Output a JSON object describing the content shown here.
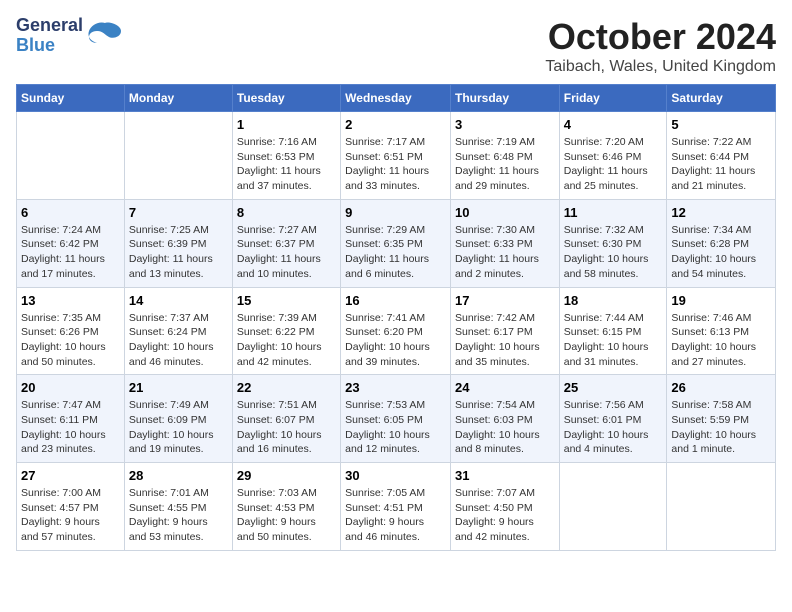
{
  "header": {
    "logo_general": "General",
    "logo_blue": "Blue",
    "month": "October 2024",
    "location": "Taibach, Wales, United Kingdom"
  },
  "weekdays": [
    "Sunday",
    "Monday",
    "Tuesday",
    "Wednesday",
    "Thursday",
    "Friday",
    "Saturday"
  ],
  "weeks": [
    [
      {
        "day": "",
        "content": ""
      },
      {
        "day": "",
        "content": ""
      },
      {
        "day": "1",
        "content": "Sunrise: 7:16 AM\nSunset: 6:53 PM\nDaylight: 11 hours\nand 37 minutes."
      },
      {
        "day": "2",
        "content": "Sunrise: 7:17 AM\nSunset: 6:51 PM\nDaylight: 11 hours\nand 33 minutes."
      },
      {
        "day": "3",
        "content": "Sunrise: 7:19 AM\nSunset: 6:48 PM\nDaylight: 11 hours\nand 29 minutes."
      },
      {
        "day": "4",
        "content": "Sunrise: 7:20 AM\nSunset: 6:46 PM\nDaylight: 11 hours\nand 25 minutes."
      },
      {
        "day": "5",
        "content": "Sunrise: 7:22 AM\nSunset: 6:44 PM\nDaylight: 11 hours\nand 21 minutes."
      }
    ],
    [
      {
        "day": "6",
        "content": "Sunrise: 7:24 AM\nSunset: 6:42 PM\nDaylight: 11 hours\nand 17 minutes."
      },
      {
        "day": "7",
        "content": "Sunrise: 7:25 AM\nSunset: 6:39 PM\nDaylight: 11 hours\nand 13 minutes."
      },
      {
        "day": "8",
        "content": "Sunrise: 7:27 AM\nSunset: 6:37 PM\nDaylight: 11 hours\nand 10 minutes."
      },
      {
        "day": "9",
        "content": "Sunrise: 7:29 AM\nSunset: 6:35 PM\nDaylight: 11 hours\nand 6 minutes."
      },
      {
        "day": "10",
        "content": "Sunrise: 7:30 AM\nSunset: 6:33 PM\nDaylight: 11 hours\nand 2 minutes."
      },
      {
        "day": "11",
        "content": "Sunrise: 7:32 AM\nSunset: 6:30 PM\nDaylight: 10 hours\nand 58 minutes."
      },
      {
        "day": "12",
        "content": "Sunrise: 7:34 AM\nSunset: 6:28 PM\nDaylight: 10 hours\nand 54 minutes."
      }
    ],
    [
      {
        "day": "13",
        "content": "Sunrise: 7:35 AM\nSunset: 6:26 PM\nDaylight: 10 hours\nand 50 minutes."
      },
      {
        "day": "14",
        "content": "Sunrise: 7:37 AM\nSunset: 6:24 PM\nDaylight: 10 hours\nand 46 minutes."
      },
      {
        "day": "15",
        "content": "Sunrise: 7:39 AM\nSunset: 6:22 PM\nDaylight: 10 hours\nand 42 minutes."
      },
      {
        "day": "16",
        "content": "Sunrise: 7:41 AM\nSunset: 6:20 PM\nDaylight: 10 hours\nand 39 minutes."
      },
      {
        "day": "17",
        "content": "Sunrise: 7:42 AM\nSunset: 6:17 PM\nDaylight: 10 hours\nand 35 minutes."
      },
      {
        "day": "18",
        "content": "Sunrise: 7:44 AM\nSunset: 6:15 PM\nDaylight: 10 hours\nand 31 minutes."
      },
      {
        "day": "19",
        "content": "Sunrise: 7:46 AM\nSunset: 6:13 PM\nDaylight: 10 hours\nand 27 minutes."
      }
    ],
    [
      {
        "day": "20",
        "content": "Sunrise: 7:47 AM\nSunset: 6:11 PM\nDaylight: 10 hours\nand 23 minutes."
      },
      {
        "day": "21",
        "content": "Sunrise: 7:49 AM\nSunset: 6:09 PM\nDaylight: 10 hours\nand 19 minutes."
      },
      {
        "day": "22",
        "content": "Sunrise: 7:51 AM\nSunset: 6:07 PM\nDaylight: 10 hours\nand 16 minutes."
      },
      {
        "day": "23",
        "content": "Sunrise: 7:53 AM\nSunset: 6:05 PM\nDaylight: 10 hours\nand 12 minutes."
      },
      {
        "day": "24",
        "content": "Sunrise: 7:54 AM\nSunset: 6:03 PM\nDaylight: 10 hours\nand 8 minutes."
      },
      {
        "day": "25",
        "content": "Sunrise: 7:56 AM\nSunset: 6:01 PM\nDaylight: 10 hours\nand 4 minutes."
      },
      {
        "day": "26",
        "content": "Sunrise: 7:58 AM\nSunset: 5:59 PM\nDaylight: 10 hours\nand 1 minute."
      }
    ],
    [
      {
        "day": "27",
        "content": "Sunrise: 7:00 AM\nSunset: 4:57 PM\nDaylight: 9 hours\nand 57 minutes."
      },
      {
        "day": "28",
        "content": "Sunrise: 7:01 AM\nSunset: 4:55 PM\nDaylight: 9 hours\nand 53 minutes."
      },
      {
        "day": "29",
        "content": "Sunrise: 7:03 AM\nSunset: 4:53 PM\nDaylight: 9 hours\nand 50 minutes."
      },
      {
        "day": "30",
        "content": "Sunrise: 7:05 AM\nSunset: 4:51 PM\nDaylight: 9 hours\nand 46 minutes."
      },
      {
        "day": "31",
        "content": "Sunrise: 7:07 AM\nSunset: 4:50 PM\nDaylight: 9 hours\nand 42 minutes."
      },
      {
        "day": "",
        "content": ""
      },
      {
        "day": "",
        "content": ""
      }
    ]
  ]
}
